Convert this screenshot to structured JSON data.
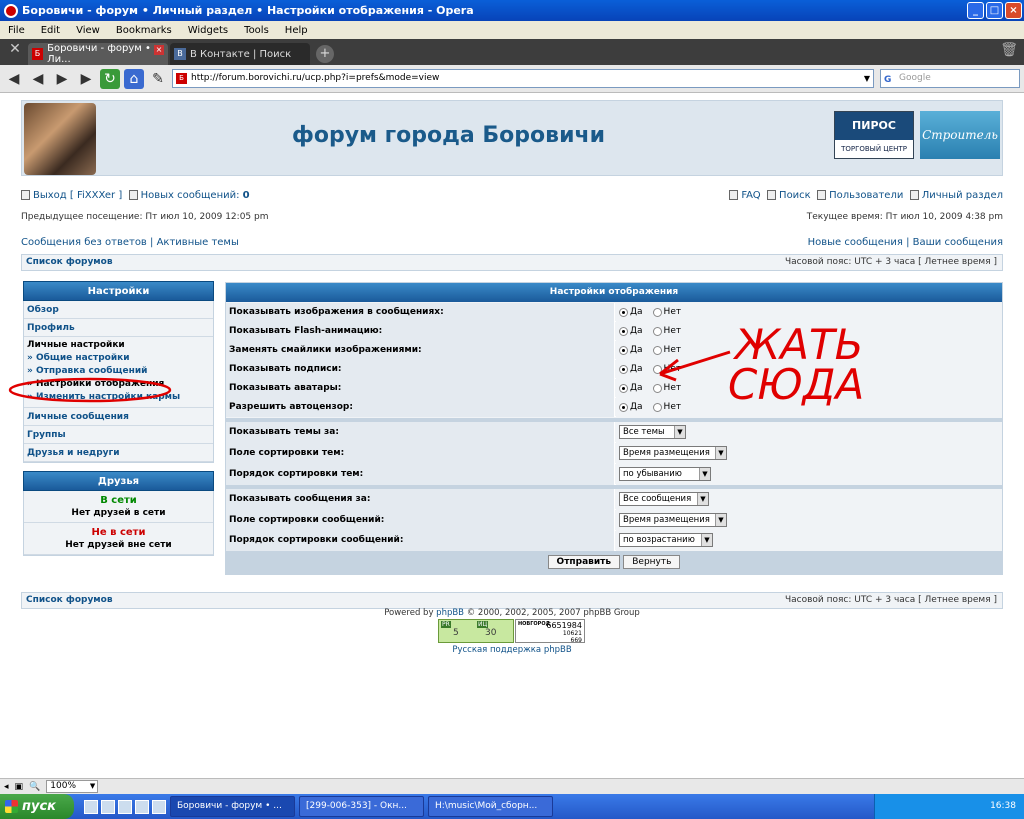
{
  "window": {
    "title": "Боровичи - форум • Личный раздел • Настройки отображения - Opera"
  },
  "menu": [
    "File",
    "Edit",
    "View",
    "Bookmarks",
    "Widgets",
    "Tools",
    "Help"
  ],
  "tabs": [
    {
      "label": "Боровичи - форум • Ли..."
    },
    {
      "label": "В Контакте | Поиск"
    }
  ],
  "address": {
    "url": "http://forum.borovichi.ru/ucp.php?i=prefs&mode=view",
    "search_placeholder": "Google"
  },
  "header": {
    "title": "форум города Боровичи",
    "banner1_name": "ПИРОС",
    "banner1_sub": "ТОРГОВЫЙ ЦЕНТР",
    "banner2_name": "Строитель"
  },
  "toplinks": {
    "logout": "Выход [ FiXXXer ]",
    "new_messages": "Новых сообщений:",
    "new_messages_count": "0",
    "faq": "FAQ",
    "search": "Поиск",
    "users": "Пользователи",
    "ucp": "Личный раздел"
  },
  "visits": {
    "last": "Предыдущее посещение: Пт июл 10, 2009 12:05 pm",
    "current": "Текущее время: Пт июл 10, 2009 4:38 pm"
  },
  "quick": {
    "unanswered": "Сообщения без ответов",
    "active": "Активные темы",
    "new_posts": "Новые сообщения",
    "your_posts": "Ваши сообщения",
    "sep": "|"
  },
  "navstrip": {
    "index": "Список форумов",
    "timezone": "Часовой пояс: UTC + 3 часа [ Летнее время ]"
  },
  "sidebar": {
    "heading": "Настройки",
    "overview": "Обзор",
    "profile": "Профиль",
    "prefs_heading": "Личные настройки",
    "prefs_items": [
      "» Общие настройки",
      "» Отправка сообщений",
      "» Настройки отображения",
      "» Изменить настройки кармы"
    ],
    "pm": "Личные сообщения",
    "groups": "Группы",
    "friends_foes": "Друзья и недруги"
  },
  "friends": {
    "heading": "Друзья",
    "online": "В сети",
    "online_none": "Нет друзей в сети",
    "offline": "Не в сети",
    "offline_none": "Нет друзей вне сети"
  },
  "panel": {
    "heading": "Настройки отображения",
    "yes": "Да",
    "no": "Нет",
    "radio_rows": [
      {
        "label": "Показывать изображения в сообщениях:",
        "value": "yes"
      },
      {
        "label": "Показывать Flash-анимацию:",
        "value": "yes"
      },
      {
        "label": "Заменять смайлики изображениями:",
        "value": "yes"
      },
      {
        "label": "Показывать подписи:",
        "value": "yes"
      },
      {
        "label": "Показывать аватары:",
        "value": "yes"
      },
      {
        "label": "Разрешить автоцензор:",
        "value": "yes"
      }
    ],
    "topic_rows": [
      {
        "label": "Показывать темы за:",
        "value": "Все темы"
      },
      {
        "label": "Поле сортировки тем:",
        "value": "Время размещения"
      },
      {
        "label": "Порядок сортировки тем:",
        "value": "по убыванию"
      }
    ],
    "post_rows": [
      {
        "label": "Показывать сообщения за:",
        "value": "Все сообщения"
      },
      {
        "label": "Поле сортировки сообщений:",
        "value": "Время размещения"
      },
      {
        "label": "Порядок сортировки сообщений:",
        "value": "по возрастанию"
      }
    ],
    "submit": "Отправить",
    "reset": "Вернуть"
  },
  "footer": {
    "powered_prefix": "Powered by",
    "powered_link": "phpBB",
    "powered_suffix": "© 2000, 2002, 2005, 2007 phpBB Group",
    "support": "Русская поддержка phpBB",
    "counter_pr_label": "PR",
    "counter_pr": "5",
    "counter_ci_label": "ИЦ",
    "counter_ci": "30",
    "counter_city": "НОВГОРОД",
    "counter_a": "6651984",
    "counter_b": "10621",
    "counter_c": "669"
  },
  "annotation": {
    "text_line1": "ЖАТЬ",
    "text_line2": "СЮДА",
    "color": "#e00000"
  },
  "status": {
    "zoom": "100%"
  },
  "taskbar": {
    "start": "пуск",
    "tasks": [
      "Боровичи - форум • ...",
      "[299-006-353] - Окн...",
      "H:\\music\\Мой_сборн..."
    ],
    "clock": "16:38"
  }
}
